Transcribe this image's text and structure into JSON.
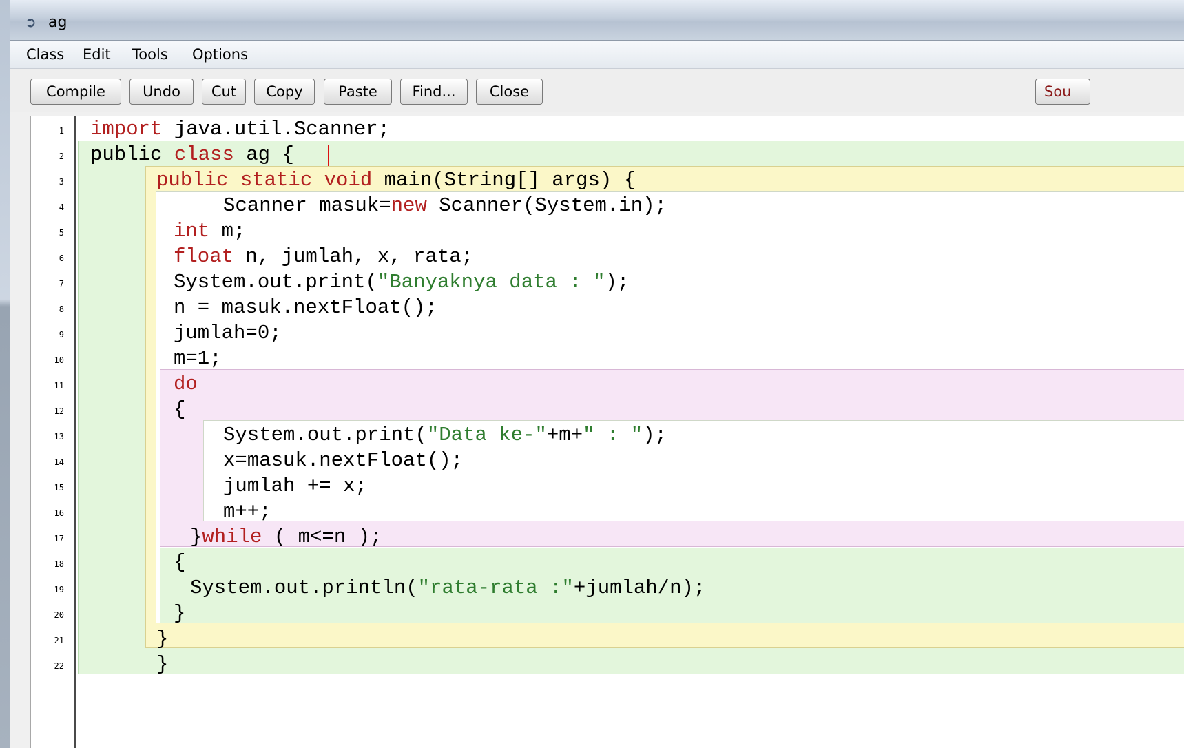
{
  "window": {
    "title": "ag",
    "icon": "bluej-bird-icon"
  },
  "menu": [
    "Class",
    "Edit",
    "Tools",
    "Options"
  ],
  "toolbar": {
    "buttons": [
      "Compile",
      "Undo",
      "Cut",
      "Copy",
      "Paste",
      "Find...",
      "Close"
    ],
    "source_toggle": "Sou"
  },
  "colors": {
    "keyword": "#b21f1f",
    "string": "#2f7d2f",
    "class_scope": "#e3f6dc",
    "method_scope": "#fbf7c8",
    "loop_scope": "#f7e6f6"
  },
  "editor": {
    "line_numbers": [
      "1",
      "2",
      "3",
      "4",
      "5",
      "6",
      "7",
      "8",
      "9",
      "10",
      "11",
      "12",
      "13",
      "14",
      "15",
      "16",
      "17",
      "18",
      "19",
      "20",
      "21",
      "22"
    ],
    "lines": [
      [
        {
          "t": "import",
          "k": "kw"
        },
        {
          "t": " java.util.Scanner;"
        }
      ],
      [
        {
          "t": "public "
        },
        {
          "t": "class",
          "k": "kw"
        },
        {
          "t": " ag {"
        }
      ],
      [
        {
          "t": "public static void",
          "k": "kw"
        },
        {
          "t": " main(String[] args) {"
        }
      ],
      [
        {
          "t": "Scanner masuk="
        },
        {
          "t": "new",
          "k": "kw"
        },
        {
          "t": " Scanner(System.in);"
        }
      ],
      [
        {
          "t": "int",
          "k": "kw"
        },
        {
          "t": " m;"
        }
      ],
      [
        {
          "t": "float",
          "k": "kw"
        },
        {
          "t": " n, jumlah, x, rata;"
        }
      ],
      [
        {
          "t": "System.out.print("
        },
        {
          "t": "\"Banyaknya data : \"",
          "k": "str"
        },
        {
          "t": ");"
        }
      ],
      [
        {
          "t": "n = masuk.nextFloat();"
        }
      ],
      [
        {
          "t": "jumlah=0;"
        }
      ],
      [
        {
          "t": "m=1;"
        }
      ],
      [
        {
          "t": "do",
          "k": "kw"
        }
      ],
      [
        {
          "t": "{"
        }
      ],
      [
        {
          "t": "System.out.print("
        },
        {
          "t": "\"Data ke-\"",
          "k": "str"
        },
        {
          "t": "+m+"
        },
        {
          "t": "\" : \"",
          "k": "str"
        },
        {
          "t": ");"
        }
      ],
      [
        {
          "t": "x=masuk.nextFloat();"
        }
      ],
      [
        {
          "t": "jumlah += x;"
        }
      ],
      [
        {
          "t": "m++;"
        }
      ],
      [
        {
          "t": "}"
        },
        {
          "t": "while",
          "k": "kw"
        },
        {
          "t": " ( m<=n );"
        }
      ],
      [
        {
          "t": "{"
        }
      ],
      [
        {
          "t": "System.out.println("
        },
        {
          "t": "\"rata-rata :\"",
          "k": "str"
        },
        {
          "t": "+jumlah/n);"
        }
      ],
      [
        {
          "t": "}"
        }
      ],
      [
        {
          "t": "}"
        }
      ],
      [
        {
          "t": "}"
        }
      ]
    ]
  }
}
